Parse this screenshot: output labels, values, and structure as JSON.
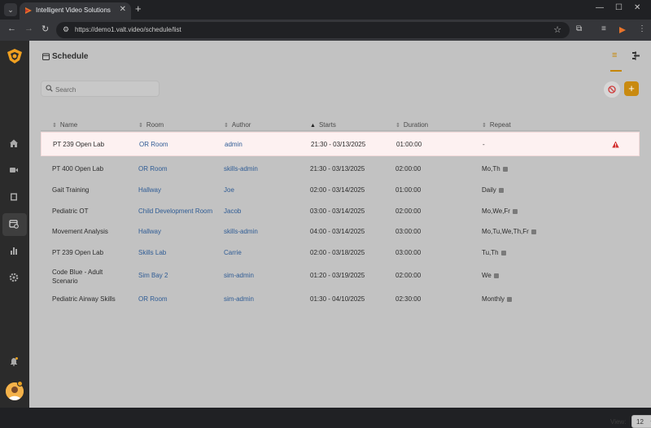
{
  "browser": {
    "tab_title": "Intelligent Video Solutions",
    "url": "https://demo1.valt.video/schedule/list",
    "tab_close": "✕",
    "new_tab": "+"
  },
  "page": {
    "title": "Schedule",
    "search_placeholder": "Search"
  },
  "columns": {
    "name": "Name",
    "room": "Room",
    "author": "Author",
    "starts": "Starts",
    "duration": "Duration",
    "repeat": "Repeat"
  },
  "rows": [
    {
      "name": "PT 239 Open Lab",
      "room": "OR Room",
      "author": "admin",
      "starts": "21:30 - 03/13/2025",
      "duration": "01:00:00",
      "repeat": "-",
      "warning": true,
      "info": false
    },
    {
      "name": "PT 400 Open Lab",
      "room": "OR Room",
      "author": "skills-admin",
      "starts": "21:30 - 03/13/2025",
      "duration": "02:00:00",
      "repeat": "Mo,Th",
      "info": true
    },
    {
      "name": "Gait Training",
      "room": "Hallway",
      "author": "Joe",
      "starts": "02:00 - 03/14/2025",
      "duration": "01:00:00",
      "repeat": "Daily",
      "info": true
    },
    {
      "name": "Pediatric OT",
      "room": "Child Development Room",
      "author": "Jacob",
      "starts": "03:00 - 03/14/2025",
      "duration": "02:00:00",
      "repeat": "Mo,We,Fr",
      "info": true
    },
    {
      "name": "Movement Analysis",
      "room": "Hallway",
      "author": "skills-admin",
      "starts": "04:00 - 03/14/2025",
      "duration": "03:00:00",
      "repeat": "Mo,Tu,We,Th,Fr",
      "info": true
    },
    {
      "name": "PT 239 Open Lab",
      "room": "Skills Lab",
      "author": "Carrie",
      "starts": "02:00 - 03/18/2025",
      "duration": "03:00:00",
      "repeat": "Tu,Th",
      "info": true
    },
    {
      "name": "Code Blue - Adult Scenario",
      "room": "Sim Bay 2",
      "author": "sim-admin",
      "starts": "01:20 - 03/19/2025",
      "duration": "02:00:00",
      "repeat": "We",
      "info": true
    },
    {
      "name": "Pediatric Airway Skills",
      "room": "OR Room",
      "author": "sim-admin",
      "starts": "01:30 - 04/10/2025",
      "duration": "02:30:00",
      "repeat": "Monthly",
      "info": true
    }
  ],
  "footer": {
    "view_label": "View:",
    "view_value": "12"
  },
  "colors": {
    "accent": "#c98a10",
    "link": "#2f5c95",
    "warning": "#d32f2f",
    "highlight_bg": "#fdf1f1"
  }
}
